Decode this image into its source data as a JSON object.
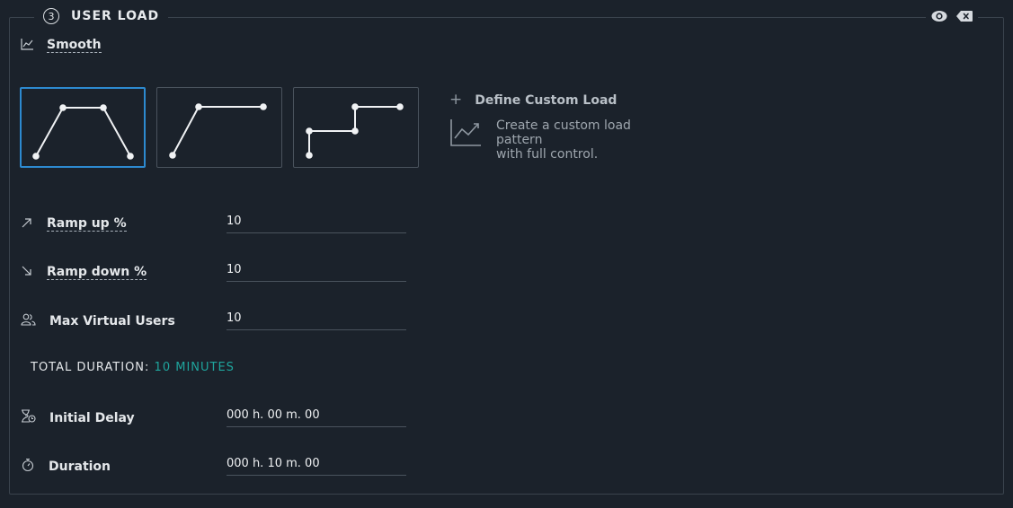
{
  "section": {
    "step_number": "3",
    "title": "USER LOAD",
    "icons": [
      "eye-icon",
      "backspace-icon"
    ]
  },
  "profile": {
    "name": "Smooth"
  },
  "patterns": [
    {
      "name": "ramp-up-down",
      "selected": true
    },
    {
      "name": "ramp-up",
      "selected": false
    },
    {
      "name": "step",
      "selected": false
    }
  ],
  "custom_load": {
    "title": "Define Custom Load",
    "description_line1": "Create a custom load pattern",
    "description_line2": "with full control."
  },
  "fields": {
    "ramp_up": {
      "label": "Ramp up %",
      "value": "10"
    },
    "ramp_down": {
      "label": "Ramp down %",
      "value": "10"
    },
    "max_users": {
      "label": "Max Virtual Users",
      "value": "10"
    }
  },
  "total_duration": {
    "label": "TOTAL DURATION:",
    "value": "10 MINUTES"
  },
  "timing": {
    "initial_delay": {
      "label": "Initial Delay",
      "value": "000 h. 00 m. 00"
    },
    "duration": {
      "label": "Duration",
      "value": "000 h. 10 m. 00"
    }
  },
  "colors": {
    "background": "#1b222b",
    "selected_border": "#2d8ad0",
    "accent_teal": "#1fa59d"
  }
}
